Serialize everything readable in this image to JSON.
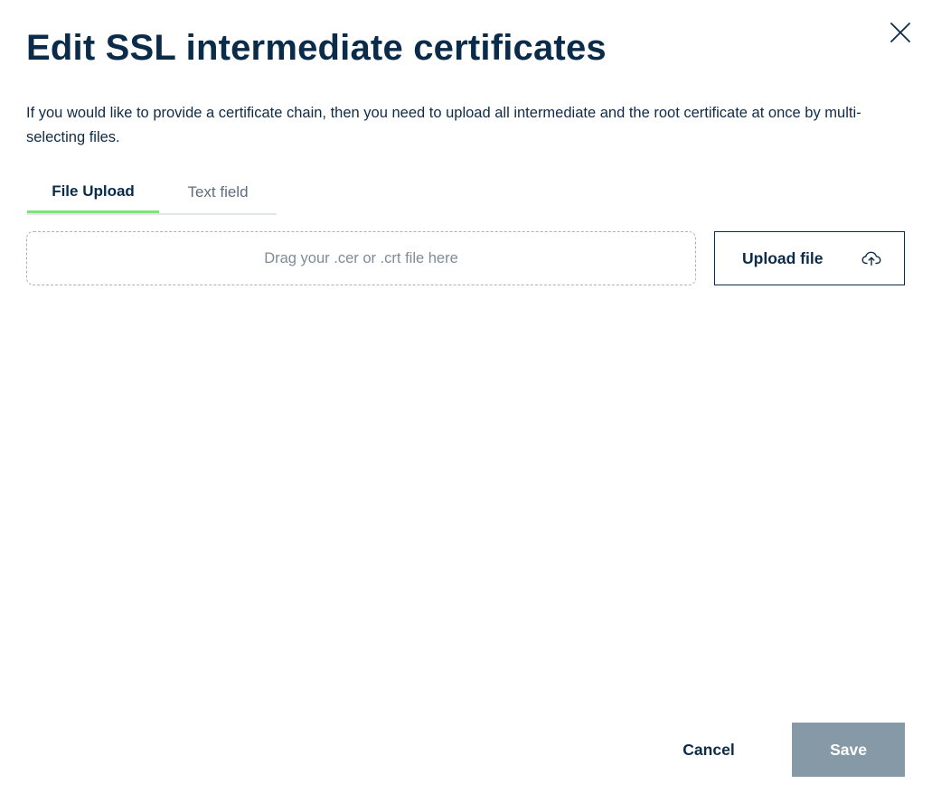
{
  "dialog": {
    "title": "Edit SSL intermediate certificates",
    "description": "If you would like to provide a certificate chain, then you need to upload all intermediate and the root certificate at once by multi-selecting files.",
    "close_icon": "close-icon"
  },
  "tabs": [
    {
      "label": "File Upload",
      "active": true
    },
    {
      "label": "Text field",
      "active": false
    }
  ],
  "upload": {
    "dropzone_text": "Drag your .cer or .crt file here",
    "button_label": "Upload file",
    "button_icon": "cloud-upload-icon"
  },
  "footer": {
    "cancel_label": "Cancel",
    "save_label": "Save"
  },
  "colors": {
    "primary_text": "#0a2c4a",
    "active_tab_indicator": "#7ee27a",
    "save_disabled_bg": "#8699a6"
  }
}
